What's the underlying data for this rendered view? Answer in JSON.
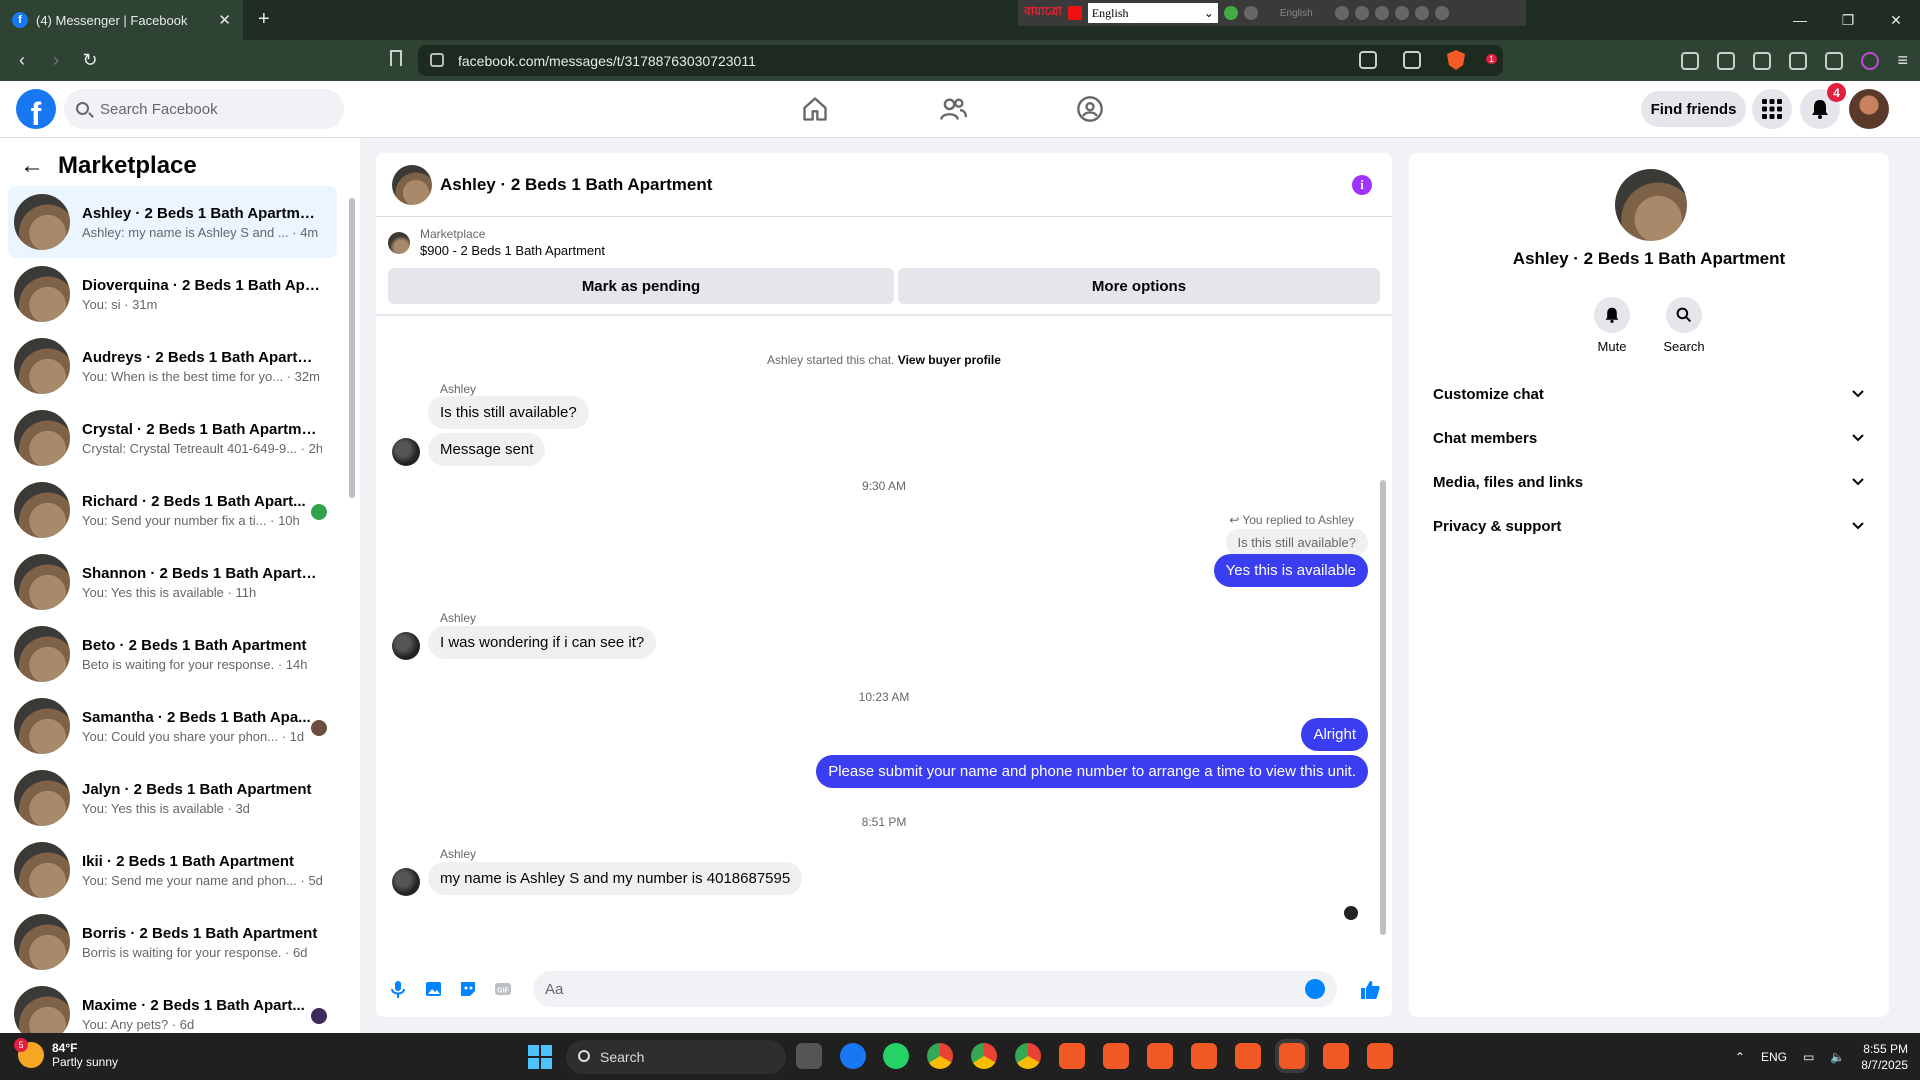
{
  "browser": {
    "tab_title": "(4) Messenger | Facebook",
    "tab_favicon": "f",
    "url": "facebook.com/messages/t/31788763030723011",
    "lang_bn": "বায়াত্রো",
    "lang_select": "English",
    "lang_small": "English",
    "brave_badge": "1"
  },
  "fb": {
    "search_placeholder": "Search Facebook",
    "find_friends": "Find friends",
    "notif_count": "4"
  },
  "sidebar": {
    "title": "Marketplace",
    "conversations": [
      {
        "name": "Ashley · 2 Beds 1 Bath Apartment",
        "sub": "Ashley: my name is Ashley S and ... · 4m"
      },
      {
        "name": "Dioverquina · 2 Beds 1 Bath Apa...",
        "sub": "You: si · 31m"
      },
      {
        "name": "Audreys · 2 Beds 1 Bath Apartm...",
        "sub": "You: When is the best time for yo... · 32m"
      },
      {
        "name": "Crystal · 2 Beds 1 Bath Apartment",
        "sub": "Crystal: Crystal Tetreault 401-649-9... · 2h"
      },
      {
        "name": "Richard · 2 Beds 1 Bath Apart...",
        "sub": "You: Send your number fix a ti... · 10h"
      },
      {
        "name": "Shannon · 2 Beds 1 Bath Apartm...",
        "sub": "You: Yes this is available · 11h"
      },
      {
        "name": "Beto · 2 Beds 1 Bath Apartment",
        "sub": "Beto is waiting for your response. · 14h"
      },
      {
        "name": "Samantha · 2 Beds 1 Bath Apa...",
        "sub": "You: Could you share your phon... · 1d"
      },
      {
        "name": "Jalyn · 2 Beds 1 Bath Apartment",
        "sub": "You: Yes this is available · 3d"
      },
      {
        "name": "Ikii · 2 Beds 1 Bath Apartment",
        "sub": "You: Send me your name and phon... · 5d"
      },
      {
        "name": "Borris · 2 Beds 1 Bath Apartment",
        "sub": "Borris is waiting for your response. · 6d"
      },
      {
        "name": "Maxime · 2 Beds 1 Bath Apart...",
        "sub": "You: Any pets? · 6d"
      }
    ]
  },
  "chat": {
    "title": "Ashley · 2 Beds 1 Bath Apartment",
    "marketplace_label": "Marketplace",
    "listing": "$900 - 2 Beds 1 Bath Apartment",
    "mark_pending": "Mark as pending",
    "more_options": "More options",
    "started": "Ashley started this chat.",
    "view_profile": "View buyer profile",
    "sender": "Ashley",
    "m1": "Is this still available?",
    "m2": "Message sent",
    "t1": "9:30 AM",
    "replied": "You replied to Ashley",
    "quote": "Is this still available?",
    "m3": "Yes this is available",
    "m4": "I was wondering if i can see it?",
    "t2": "10:23 AM",
    "m5": "Alright",
    "m6": "Please submit your name and phone number to arrange a time to view this unit.",
    "t3": "8:51 PM",
    "m7": "my name is Ashley S and my number is 4018687595",
    "placeholder": "Aa"
  },
  "right": {
    "name": "Ashley · 2 Beds 1 Bath Apartment",
    "mute": "Mute",
    "search": "Search",
    "sections": [
      "Customize chat",
      "Chat members",
      "Media, files and links",
      "Privacy & support"
    ]
  },
  "taskbar": {
    "temp": "84°F",
    "weather": "Partly sunny",
    "weather_badge": "5",
    "search": "Search",
    "lang": "ENG",
    "time": "8:55 PM",
    "date": "8/7/2025"
  }
}
